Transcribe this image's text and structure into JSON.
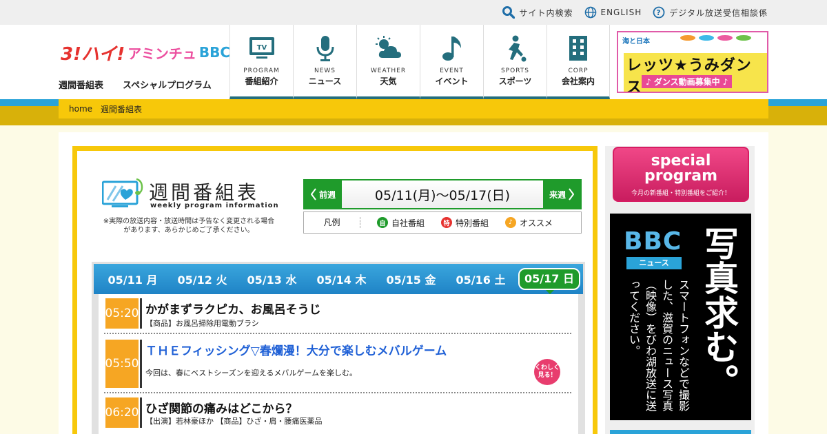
{
  "utility": {
    "search": "サイト内検索",
    "english": "ENGLISH",
    "digital": "デジタル放送受信相談係"
  },
  "logo": {
    "part1": "3!ハイ!",
    "part2": "アミンチュ",
    "part3": "BBC"
  },
  "subnav": [
    "週間番組表",
    "スペシャルプログラム"
  ],
  "gnav": [
    {
      "en": "PROGRAM",
      "jp": "番組紹介",
      "icon": "tv-icon"
    },
    {
      "en": "NEWS",
      "jp": "ニュース",
      "icon": "microphone-icon"
    },
    {
      "en": "WEATHER",
      "jp": "天気",
      "icon": "weather-icon"
    },
    {
      "en": "EVENT",
      "jp": "イベント",
      "icon": "music-note-icon"
    },
    {
      "en": "SPORTS",
      "jp": "スポーツ",
      "icon": "sports-icon"
    },
    {
      "en": "CORP",
      "jp": "会社案内",
      "icon": "building-icon"
    }
  ],
  "dance_banner": {
    "top": "海と日本",
    "title": "レッツ★うみダンス",
    "sub": "♪ ダンス動画募集中 ♪"
  },
  "breadcrumb": [
    "home",
    "週間番組表"
  ],
  "page_title": "週間番組表",
  "page_title_en": "weekly program information",
  "note": "※実際の放送内容・放送時間は予告なく変更される場合があります、あらかじめご了承ください。",
  "week_nav": {
    "prev": "前週",
    "range": "05/11(月)～05/17(日)",
    "next": "来週"
  },
  "legend": {
    "label": "凡例",
    "items": [
      {
        "mark": "自",
        "text": "自社番組",
        "color": "#1f9b2b"
      },
      {
        "mark": "特",
        "text": "特別番組",
        "color": "#e6322f"
      },
      {
        "mark": "♪",
        "text": "オススメ",
        "color": "#f6a623"
      }
    ]
  },
  "days": [
    "05/11 月",
    "05/12 火",
    "05/13 水",
    "05/14 木",
    "05/15 金",
    "05/16 土",
    "05/17 日"
  ],
  "active_day": 6,
  "programs": [
    {
      "time": "05:20",
      "title": "かがまずラクピカ、お風呂そうじ",
      "desc": "【商品】お風呂掃除用電動ブラシ"
    },
    {
      "time": "05:50",
      "title": "ＴＨＥフィッシング▽春爛漫！大分で楽しむメバルゲーム",
      "desc": "今回は、春にベストシーズンを迎えるメバルゲームを楽しむ。",
      "more": "くわしく見る！"
    },
    {
      "time": "06:20",
      "title": "ひざ関節の痛みはどこから？",
      "desc": "【出演】若林豪ほか 【商品】ひざ・肩・腰痛医薬品"
    }
  ],
  "side_special": {
    "title": "special program",
    "sub": "今月の新番組・特別番組をご紹介！"
  },
  "side_news": {
    "logo": "BBC",
    "tag": "ニュース",
    "big": "写真求む。",
    "text": "スマートフォンなどで撮影した、滋賀のニュース写真（映像）をびわ湖放送に送ってください。"
  }
}
